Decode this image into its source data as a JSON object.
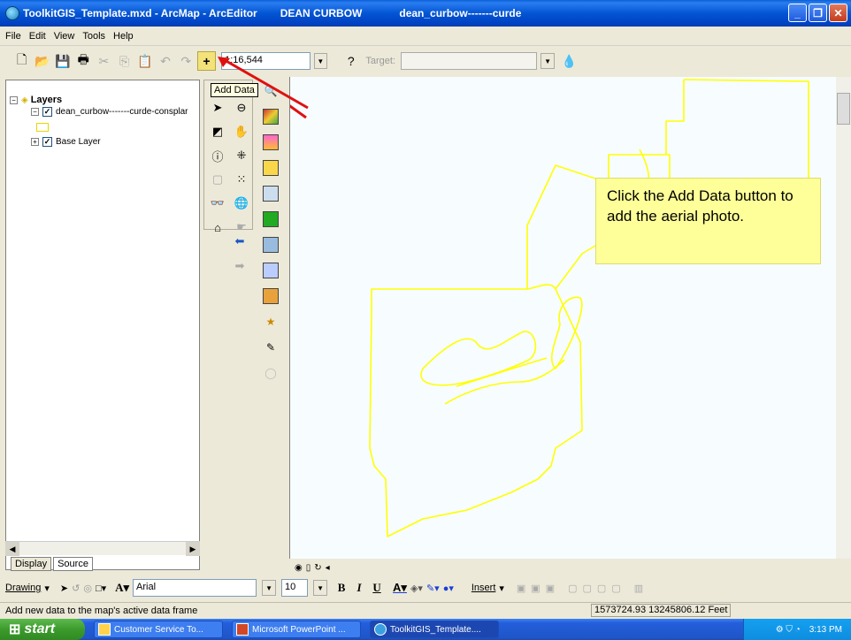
{
  "window": {
    "title": "ToolkitGIS_Template.mxd - ArcMap - ArcEditor",
    "user": "DEAN CURBOW",
    "document": "dean_curbow-------curde"
  },
  "menu": [
    "File",
    "Edit",
    "View",
    "Tools",
    "Help"
  ],
  "toolbar": {
    "scale": "1:16,544",
    "target_label": "Target:"
  },
  "tooltip": "Add Data",
  "toc": {
    "root": "Layers",
    "layer1": "dean_curbow-------curde-consplar",
    "layer2": "Base Layer",
    "tabs": [
      "Display",
      "Source"
    ]
  },
  "callout": "Click the Add Data button to add the aerial photo.",
  "drawing": {
    "drawing_label": "Drawing",
    "font": "Arial",
    "size": "10",
    "insert_label": "Insert"
  },
  "status": {
    "message": "Add new data to the map's active data frame",
    "coords": "1573724.93  13245806.12 Feet"
  },
  "taskbar": {
    "start": "start",
    "tasks": [
      "Customer Service To...",
      "Microsoft PowerPoint ...",
      "ToolkitGIS_Template...."
    ],
    "clock": "3:13 PM"
  },
  "colors": {
    "parcel_outline": "#ffff00",
    "callout_bg": "#ffff99",
    "arrow": "#e01010"
  }
}
